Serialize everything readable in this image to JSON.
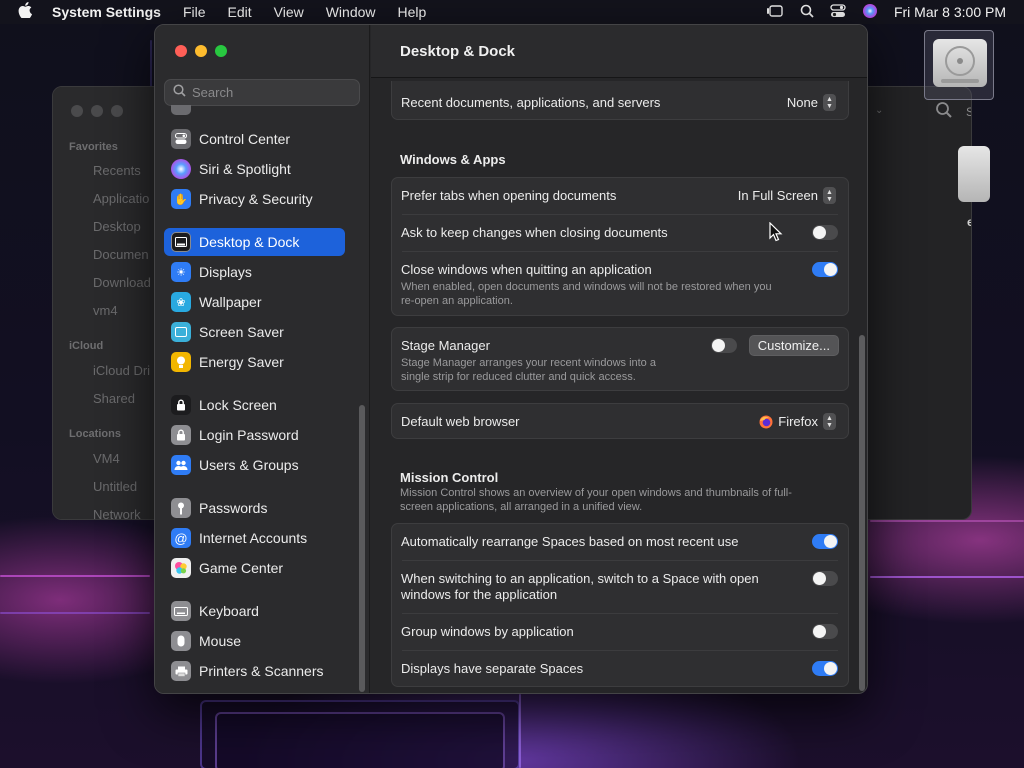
{
  "menubar": {
    "app_name": "System Settings",
    "menus": [
      "File",
      "Edit",
      "View",
      "Window",
      "Help"
    ],
    "clock": "Fri Mar 8  3:00 PM"
  },
  "finder": {
    "sections": [
      "Favorites",
      "iCloud",
      "Locations"
    ],
    "favorites": [
      "Recents",
      "Applicatio",
      "Desktop",
      "Documen",
      "Download",
      "vm4"
    ],
    "icloud": [
      "iCloud Dri",
      "Shared"
    ],
    "locations": [
      "VM4",
      "Untitled",
      "Network"
    ],
    "partial_text": "ed",
    "partial_label": "S"
  },
  "settings": {
    "search_placeholder": "Search",
    "sidebar": {
      "items": [
        {
          "label": "Control Center",
          "icon": "control-center-icon",
          "color": "#6b6b6f"
        },
        {
          "label": "Siri & Spotlight",
          "icon": "siri-icon",
          "color": "#b140d9"
        },
        {
          "label": "Privacy & Security",
          "icon": "hand-icon",
          "color": "#2f7cf5"
        },
        {
          "label": "Desktop & Dock",
          "icon": "dock-icon",
          "color": "#1c1c1e",
          "active": true
        },
        {
          "label": "Displays",
          "icon": "sun-icon",
          "color": "#2f7cf5"
        },
        {
          "label": "Wallpaper",
          "icon": "flower-icon",
          "color": "#29a9e0"
        },
        {
          "label": "Screen Saver",
          "icon": "screensaver-icon",
          "color": "#3bb0d9"
        },
        {
          "label": "Energy Saver",
          "icon": "bulb-icon",
          "color": "#f2b600"
        },
        {
          "label": "Lock Screen",
          "icon": "lock-icon",
          "color": "#1c1c1e"
        },
        {
          "label": "Login Password",
          "icon": "padlock-icon",
          "color": "#8e8e92"
        },
        {
          "label": "Users & Groups",
          "icon": "users-icon",
          "color": "#2f7cf5"
        },
        {
          "label": "Passwords",
          "icon": "key-icon",
          "color": "#8e8e92"
        },
        {
          "label": "Internet Accounts",
          "icon": "at-icon",
          "color": "#2f7cf5"
        },
        {
          "label": "Game Center",
          "icon": "game-center-icon",
          "color": "#f0f0f0"
        },
        {
          "label": "Keyboard",
          "icon": "keyboard-icon",
          "color": "#8e8e92"
        },
        {
          "label": "Mouse",
          "icon": "mouse-icon",
          "color": "#8e8e92"
        },
        {
          "label": "Printers & Scanners",
          "icon": "printer-icon",
          "color": "#8e8e92"
        }
      ]
    },
    "main": {
      "title": "Desktop & Dock",
      "recent_docs": {
        "label": "Recent documents, applications, and servers",
        "value": "None"
      },
      "windows_apps": {
        "title": "Windows & Apps",
        "prefer_tabs": {
          "label": "Prefer tabs when opening documents",
          "value": "In Full Screen"
        },
        "ask_keep": {
          "label": "Ask to keep changes when closing documents",
          "on": false
        },
        "close_windows": {
          "label": "Close windows when quitting an application",
          "desc_line1": "When enabled, open documents and windows will not be restored when you",
          "desc_line2": "re-open an application.",
          "on": true
        }
      },
      "stage_manager": {
        "label": "Stage Manager",
        "desc_line1": "Stage Manager arranges your recent windows into a",
        "desc_line2": "single strip for reduced clutter and quick access.",
        "on": false,
        "customize": "Customize..."
      },
      "browser": {
        "label": "Default web browser",
        "value": "Firefox"
      },
      "mission_control": {
        "title": "Mission Control",
        "desc_line1": "Mission Control shows an overview of your open windows and thumbnails of full-",
        "desc_line2": "screen applications, all arranged in a unified view.",
        "auto_rearrange": {
          "label": "Automatically rearrange Spaces based on most recent use",
          "on": true
        },
        "switch_space": {
          "label_line1": "When switching to an application, switch to a Space with open",
          "label_line2": "windows for the application",
          "on": false
        },
        "group_windows": {
          "label": "Group windows by application",
          "on": false
        },
        "separate_spaces": {
          "label": "Displays have separate Spaces",
          "on": true
        }
      }
    }
  }
}
